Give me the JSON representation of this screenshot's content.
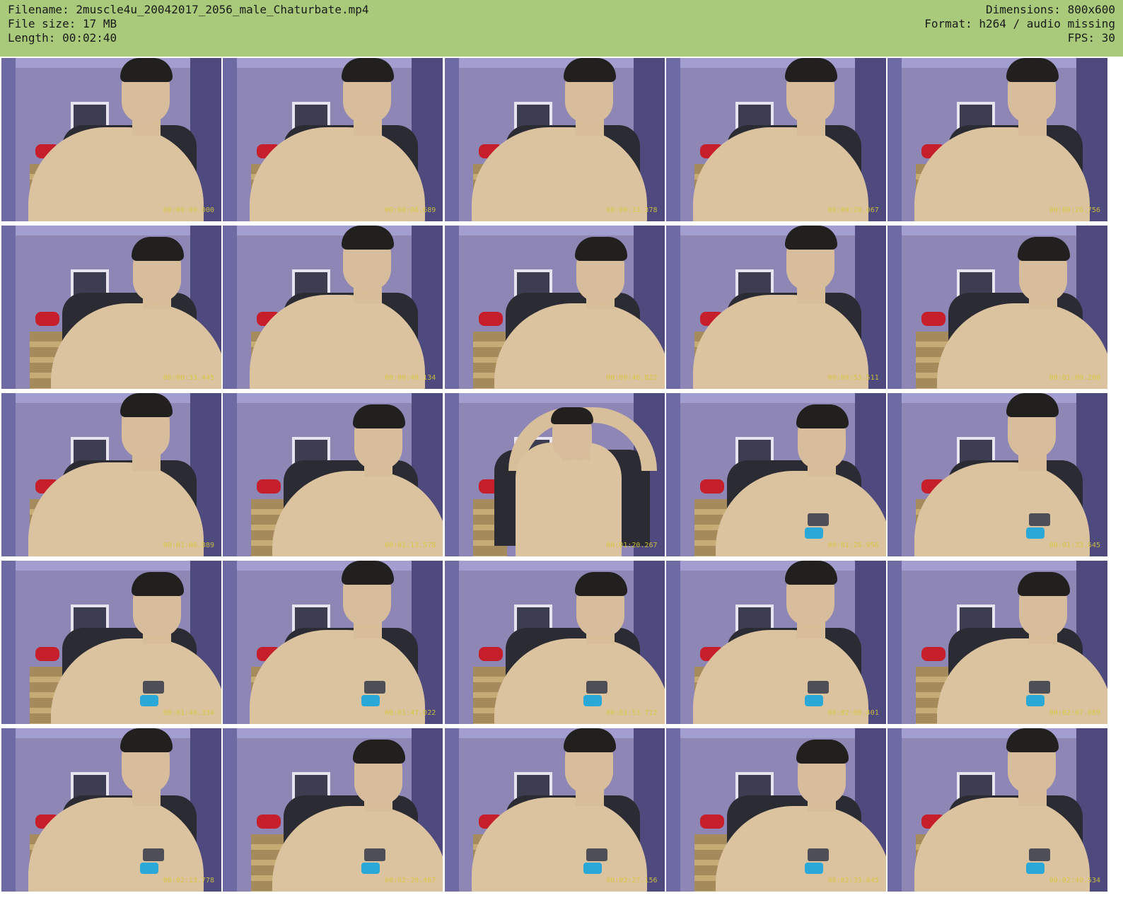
{
  "header": {
    "filename": "Filename: 2muscle4u_20042017_2056_male_Chaturbate.mp4",
    "filesize": "File size: 17 MB",
    "length": "Length: 00:02:40",
    "dimensions": "Dimensions: 800x600",
    "format": "Format: h264 / audio missing",
    "fps": "FPS: 30"
  },
  "thumbnails": [
    {
      "time": "00:00:00.000"
    },
    {
      "time": "00:00:06.689"
    },
    {
      "time": "00:00:13.378"
    },
    {
      "time": "00:00:20.067"
    },
    {
      "time": "00:00:26.756"
    },
    {
      "time": "00:00:33.445"
    },
    {
      "time": "00:00:40.134"
    },
    {
      "time": "00:00:46.822"
    },
    {
      "time": "00:00:53.511"
    },
    {
      "time": "00:01:00.200"
    },
    {
      "time": "00:01:06.889"
    },
    {
      "time": "00:01:13.578"
    },
    {
      "time": "00:01:20.267"
    },
    {
      "time": "00:01:26.956"
    },
    {
      "time": "00:01:33.645"
    },
    {
      "time": "00:01:40.334"
    },
    {
      "time": "00:01:47.022"
    },
    {
      "time": "00:01:53.712"
    },
    {
      "time": "00:02:00.401"
    },
    {
      "time": "00:02:07.089"
    },
    {
      "time": "00:02:13.778"
    },
    {
      "time": "00:02:20.467"
    },
    {
      "time": "00:02:27.156"
    },
    {
      "time": "00:02:33.845"
    },
    {
      "time": "00:02:40.534"
    }
  ]
}
